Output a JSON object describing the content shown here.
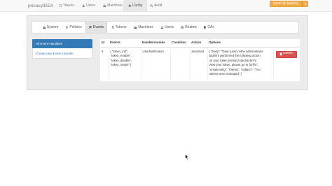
{
  "navbar": {
    "brand": "privacyIDEA",
    "items": [
      {
        "label": "Tokens",
        "icon": "tablet-icon"
      },
      {
        "label": "Users",
        "icon": "user-icon"
      },
      {
        "label": "Machines",
        "icon": "hdd-icon"
      },
      {
        "label": "Config",
        "icon": "cog-icon",
        "active": true
      },
      {
        "label": "Audit",
        "icon": "search-icon"
      }
    ],
    "user_button": "super @ (admin)"
  },
  "config_tabs": {
    "items": [
      {
        "label": "System",
        "icon": "hdd-icon"
      },
      {
        "label": "Policies",
        "icon": "lightbulb-icon"
      },
      {
        "label": "Events",
        "icon": "flag-icon",
        "active": true
      },
      {
        "label": "Tokens",
        "icon": "tablet-icon"
      },
      {
        "label": "Machines",
        "icon": "hdd-icon"
      },
      {
        "label": "Users",
        "icon": "user-icon"
      },
      {
        "label": "Realms",
        "icon": "globe-icon"
      },
      {
        "label": "CAs",
        "icon": "bookmark-icon"
      }
    ]
  },
  "sidebar": {
    "items": [
      {
        "label": "All Event Handlers",
        "active": true
      },
      {
        "label": "Create new Event Handler"
      }
    ]
  },
  "event_table": {
    "headers": [
      "Id",
      "Events",
      "Handlermodule",
      "Condition",
      "Action",
      "Options"
    ],
    "rows": [
      {
        "id": "5",
        "events": [
          "[ \"token_init\",",
          "\"token_enable\",",
          "\"token_disable\",",
          "\"token_setpin\" ]"
        ],
        "handlermodule": "UserNotification",
        "condition": "",
        "action": "sendmail",
        "options": [
          "{ \"body\": \"Dear {user},\\nthe administrator",
          "{admin} performed the following action",
          "on your token {serial}.\\n{action}\\nTo",
          "view your token, please go to {url}\\n\",",
          "\"emailconfig\": \"themis\", \"subject\": \"You",
          "tokens were managed\" }"
        ],
        "delete_label": "Delete"
      }
    ]
  },
  "colors": {
    "primary": "#337ab7",
    "danger": "#d9534f",
    "warning": "#f0ad4e",
    "navbar_bg": "#f8f8f8",
    "panel_bg": "#ececec"
  }
}
